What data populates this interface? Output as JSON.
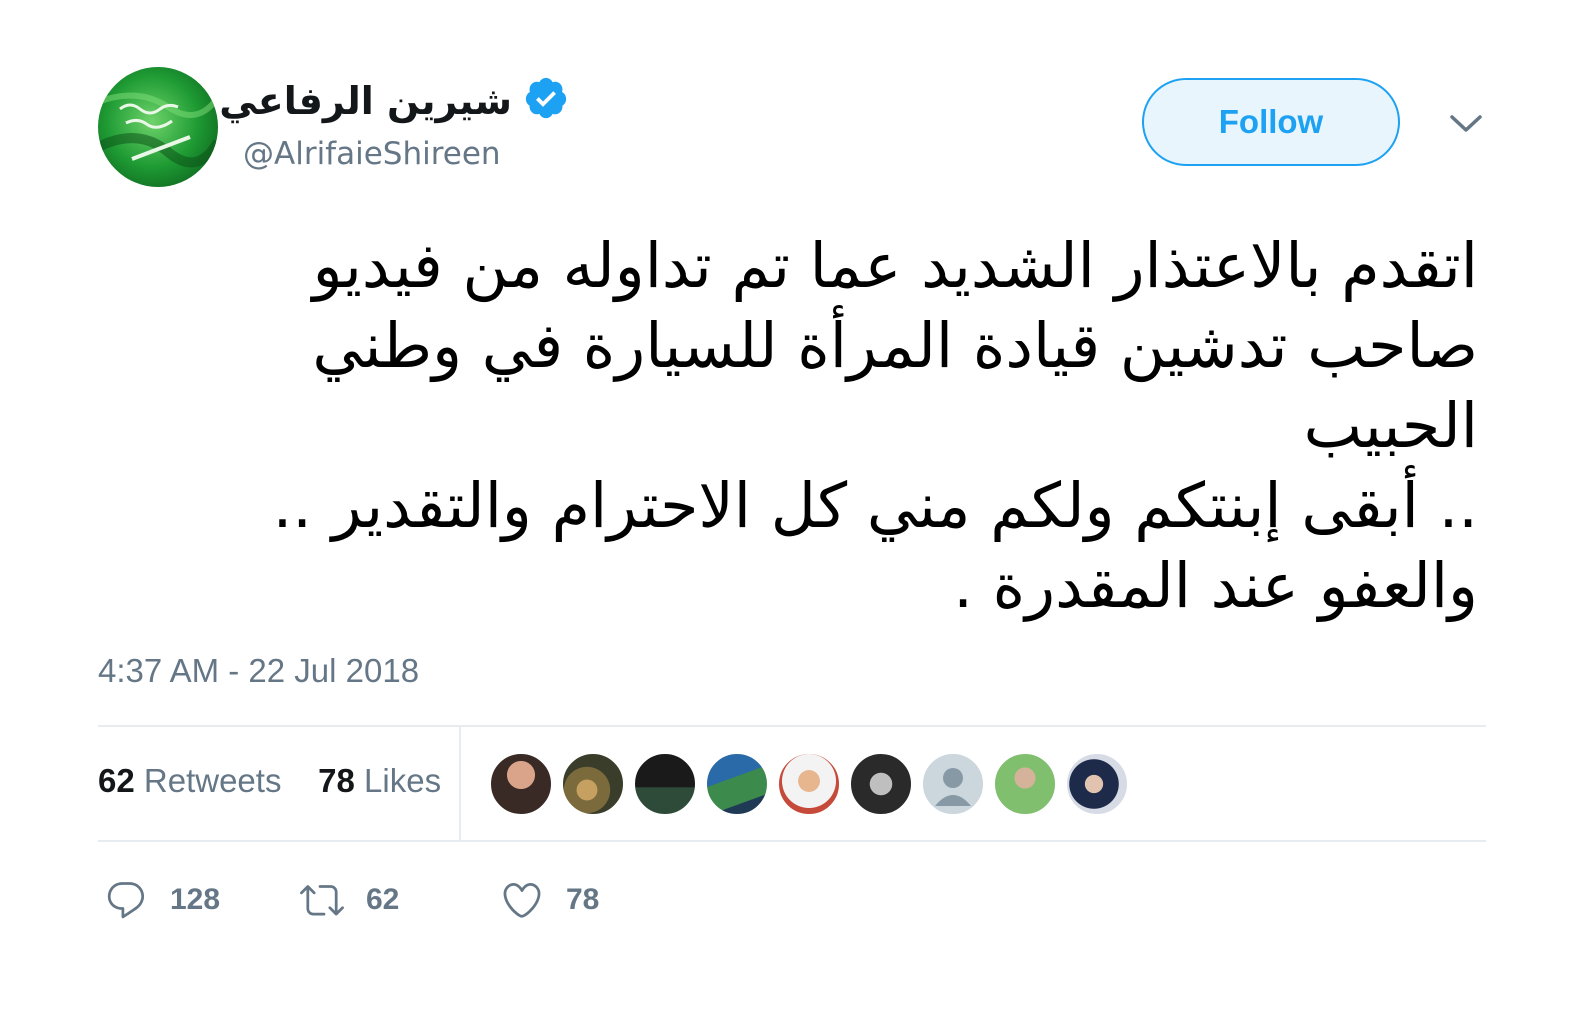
{
  "author": {
    "display_name": "شيرين الرفاعي",
    "handle": "@AlrifaieShireen",
    "verified": true
  },
  "follow_button": {
    "label": "Follow"
  },
  "tweet": {
    "lines": [
      "اتقدم بالاعتذار الشديد عما تم تداوله من فيديو",
      "صاحب تدشين قيادة المرأة للسيارة في وطني",
      "الحبيب",
      ".. أبقى إبنتكم ولكم مني كل الاحترام والتقدير ..",
      "والعفو عند المقدرة ."
    ],
    "timestamp": "4:37 AM - 22 Jul 2018"
  },
  "stats": {
    "retweets_count": "62",
    "retweets_label": "Retweets",
    "likes_count": "78",
    "likes_label": "Likes"
  },
  "actions": {
    "reply_count": "128",
    "retweet_count": "62",
    "like_count": "78"
  },
  "colors": {
    "accent": "#1da1f2",
    "muted": "#657786",
    "divider": "#e6ecf0",
    "text": "#14171a"
  }
}
